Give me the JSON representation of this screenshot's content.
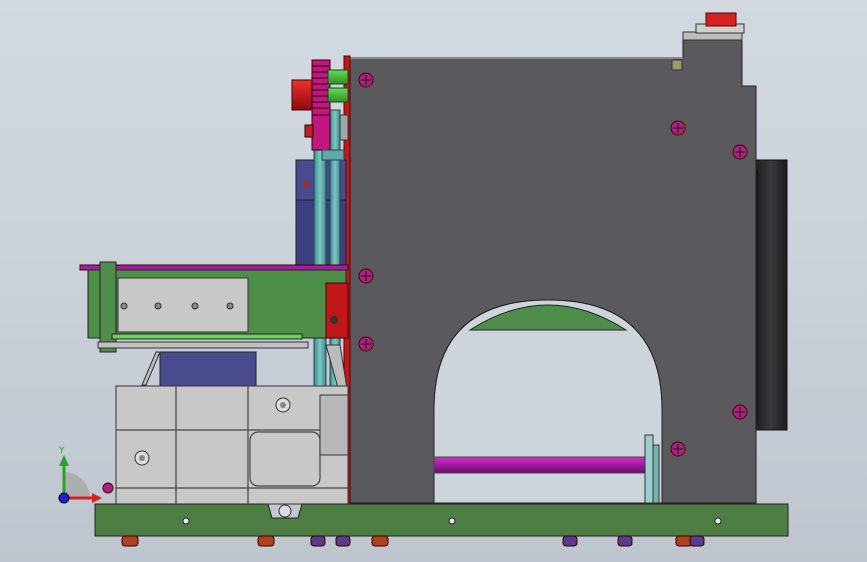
{
  "viewport": {
    "background_top": "#d2d9e1",
    "background_bottom": "#bec5ce"
  },
  "triad": {
    "y_label": "Y",
    "x_label": "X",
    "y_color": "#2ea02e",
    "x_color": "#d62020",
    "z_color": "#2020d0"
  },
  "colors": {
    "frame": "#5a5a5e",
    "base_plate": "#4e7e44",
    "green_part": "#4f8e4a",
    "gearbox": "#c8c8c8",
    "motor_blue": "#4a4a8e",
    "purple_shaft": "#a020a0",
    "red_part": "#c01818",
    "teal_shaft": "#5faaa8",
    "arch_top": "#4f8e4a",
    "screw": "#b02080",
    "dark_drum": "#2a2a2e"
  }
}
